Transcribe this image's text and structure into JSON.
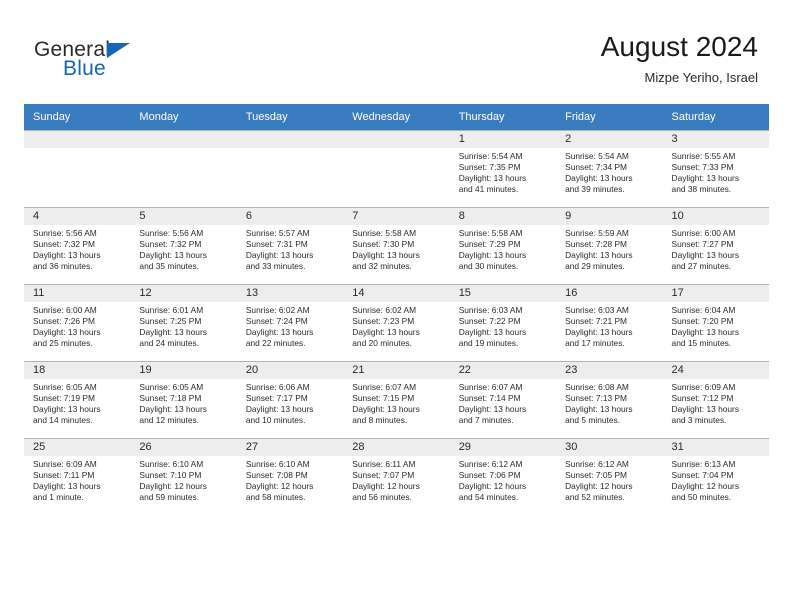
{
  "logo": {
    "word1": "General",
    "word2": "Blue",
    "triangle_color": "#1565b8"
  },
  "header": {
    "title": "August 2024",
    "subtitle": "Mizpe Yeriho, Israel",
    "header_bg": "#3a7cc0",
    "daynum_bg": "#ededed"
  },
  "weekdays": [
    "Sunday",
    "Monday",
    "Tuesday",
    "Wednesday",
    "Thursday",
    "Friday",
    "Saturday"
  ],
  "weeks": [
    [
      {
        "day": "",
        "lines": []
      },
      {
        "day": "",
        "lines": []
      },
      {
        "day": "",
        "lines": []
      },
      {
        "day": "",
        "lines": []
      },
      {
        "day": "1",
        "lines": [
          "Sunrise: 5:54 AM",
          "Sunset: 7:35 PM",
          "Daylight: 13 hours",
          "and 41 minutes."
        ]
      },
      {
        "day": "2",
        "lines": [
          "Sunrise: 5:54 AM",
          "Sunset: 7:34 PM",
          "Daylight: 13 hours",
          "and 39 minutes."
        ]
      },
      {
        "day": "3",
        "lines": [
          "Sunrise: 5:55 AM",
          "Sunset: 7:33 PM",
          "Daylight: 13 hours",
          "and 38 minutes."
        ]
      }
    ],
    [
      {
        "day": "4",
        "lines": [
          "Sunrise: 5:56 AM",
          "Sunset: 7:32 PM",
          "Daylight: 13 hours",
          "and 36 minutes."
        ]
      },
      {
        "day": "5",
        "lines": [
          "Sunrise: 5:56 AM",
          "Sunset: 7:32 PM",
          "Daylight: 13 hours",
          "and 35 minutes."
        ]
      },
      {
        "day": "6",
        "lines": [
          "Sunrise: 5:57 AM",
          "Sunset: 7:31 PM",
          "Daylight: 13 hours",
          "and 33 minutes."
        ]
      },
      {
        "day": "7",
        "lines": [
          "Sunrise: 5:58 AM",
          "Sunset: 7:30 PM",
          "Daylight: 13 hours",
          "and 32 minutes."
        ]
      },
      {
        "day": "8",
        "lines": [
          "Sunrise: 5:58 AM",
          "Sunset: 7:29 PM",
          "Daylight: 13 hours",
          "and 30 minutes."
        ]
      },
      {
        "day": "9",
        "lines": [
          "Sunrise: 5:59 AM",
          "Sunset: 7:28 PM",
          "Daylight: 13 hours",
          "and 29 minutes."
        ]
      },
      {
        "day": "10",
        "lines": [
          "Sunrise: 6:00 AM",
          "Sunset: 7:27 PM",
          "Daylight: 13 hours",
          "and 27 minutes."
        ]
      }
    ],
    [
      {
        "day": "11",
        "lines": [
          "Sunrise: 6:00 AM",
          "Sunset: 7:26 PM",
          "Daylight: 13 hours",
          "and 25 minutes."
        ]
      },
      {
        "day": "12",
        "lines": [
          "Sunrise: 6:01 AM",
          "Sunset: 7:25 PM",
          "Daylight: 13 hours",
          "and 24 minutes."
        ]
      },
      {
        "day": "13",
        "lines": [
          "Sunrise: 6:02 AM",
          "Sunset: 7:24 PM",
          "Daylight: 13 hours",
          "and 22 minutes."
        ]
      },
      {
        "day": "14",
        "lines": [
          "Sunrise: 6:02 AM",
          "Sunset: 7:23 PM",
          "Daylight: 13 hours",
          "and 20 minutes."
        ]
      },
      {
        "day": "15",
        "lines": [
          "Sunrise: 6:03 AM",
          "Sunset: 7:22 PM",
          "Daylight: 13 hours",
          "and 19 minutes."
        ]
      },
      {
        "day": "16",
        "lines": [
          "Sunrise: 6:03 AM",
          "Sunset: 7:21 PM",
          "Daylight: 13 hours",
          "and 17 minutes."
        ]
      },
      {
        "day": "17",
        "lines": [
          "Sunrise: 6:04 AM",
          "Sunset: 7:20 PM",
          "Daylight: 13 hours",
          "and 15 minutes."
        ]
      }
    ],
    [
      {
        "day": "18",
        "lines": [
          "Sunrise: 6:05 AM",
          "Sunset: 7:19 PM",
          "Daylight: 13 hours",
          "and 14 minutes."
        ]
      },
      {
        "day": "19",
        "lines": [
          "Sunrise: 6:05 AM",
          "Sunset: 7:18 PM",
          "Daylight: 13 hours",
          "and 12 minutes."
        ]
      },
      {
        "day": "20",
        "lines": [
          "Sunrise: 6:06 AM",
          "Sunset: 7:17 PM",
          "Daylight: 13 hours",
          "and 10 minutes."
        ]
      },
      {
        "day": "21",
        "lines": [
          "Sunrise: 6:07 AM",
          "Sunset: 7:15 PM",
          "Daylight: 13 hours",
          "and 8 minutes."
        ]
      },
      {
        "day": "22",
        "lines": [
          "Sunrise: 6:07 AM",
          "Sunset: 7:14 PM",
          "Daylight: 13 hours",
          "and 7 minutes."
        ]
      },
      {
        "day": "23",
        "lines": [
          "Sunrise: 6:08 AM",
          "Sunset: 7:13 PM",
          "Daylight: 13 hours",
          "and 5 minutes."
        ]
      },
      {
        "day": "24",
        "lines": [
          "Sunrise: 6:09 AM",
          "Sunset: 7:12 PM",
          "Daylight: 13 hours",
          "and 3 minutes."
        ]
      }
    ],
    [
      {
        "day": "25",
        "lines": [
          "Sunrise: 6:09 AM",
          "Sunset: 7:11 PM",
          "Daylight: 13 hours",
          "and 1 minute."
        ]
      },
      {
        "day": "26",
        "lines": [
          "Sunrise: 6:10 AM",
          "Sunset: 7:10 PM",
          "Daylight: 12 hours",
          "and 59 minutes."
        ]
      },
      {
        "day": "27",
        "lines": [
          "Sunrise: 6:10 AM",
          "Sunset: 7:08 PM",
          "Daylight: 12 hours",
          "and 58 minutes."
        ]
      },
      {
        "day": "28",
        "lines": [
          "Sunrise: 6:11 AM",
          "Sunset: 7:07 PM",
          "Daylight: 12 hours",
          "and 56 minutes."
        ]
      },
      {
        "day": "29",
        "lines": [
          "Sunrise: 6:12 AM",
          "Sunset: 7:06 PM",
          "Daylight: 12 hours",
          "and 54 minutes."
        ]
      },
      {
        "day": "30",
        "lines": [
          "Sunrise: 6:12 AM",
          "Sunset: 7:05 PM",
          "Daylight: 12 hours",
          "and 52 minutes."
        ]
      },
      {
        "day": "31",
        "lines": [
          "Sunrise: 6:13 AM",
          "Sunset: 7:04 PM",
          "Daylight: 12 hours",
          "and 50 minutes."
        ]
      }
    ]
  ]
}
